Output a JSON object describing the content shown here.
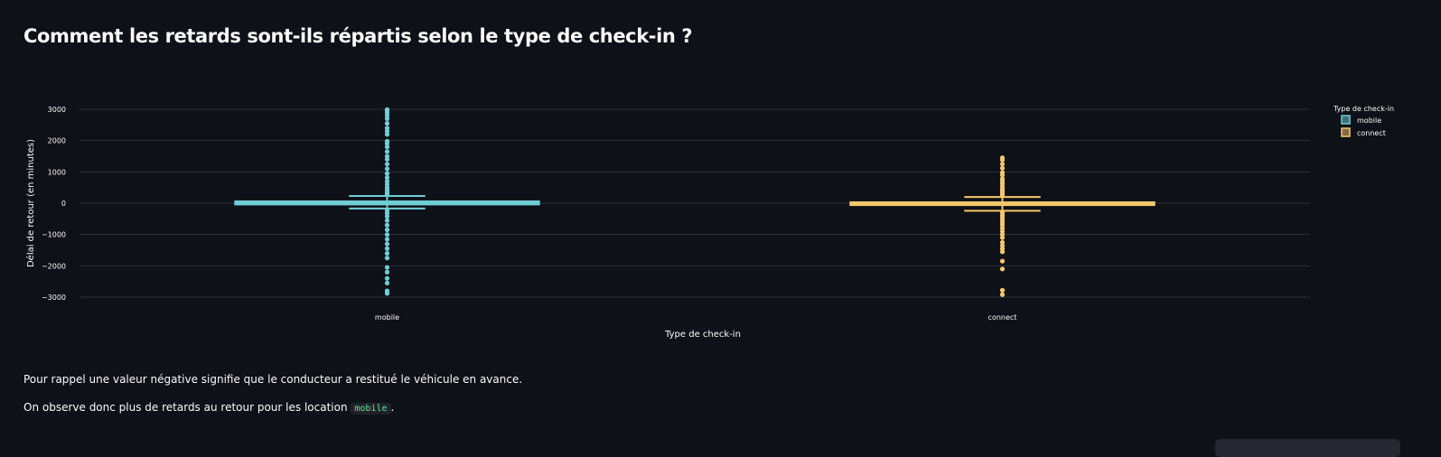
{
  "page": {
    "title": "Comment les retards sont-ils répartis selon le type de check-in ?",
    "note1": "Pour rappel une valeur négative signifie que le conducteur a restitué le véhicule en avance.",
    "note2_before": "On observe donc plus de retards au retour pour les location",
    "note2_code": "mobile",
    "note2_after": "."
  },
  "chart_data": {
    "type": "box",
    "title": "",
    "xlabel": "Type de check-in",
    "ylabel": "Délai de retour (en minutes)",
    "ylim": [
      -3000,
      3000
    ],
    "yticks": [
      3000,
      2000,
      1000,
      0,
      -1000,
      -2000,
      -3000
    ],
    "ytick_labels": [
      "3000",
      "2000",
      "1000",
      "0",
      "−1000",
      "−2000",
      "−3000"
    ],
    "grid": true,
    "legend": {
      "title": "Type de check-in",
      "placement": "top-right"
    },
    "categories": [
      "mobile",
      "connect"
    ],
    "series": [
      {
        "name": "mobile",
        "color": "#6fcfd6",
        "q1": -40,
        "median": 10,
        "q3": 60,
        "whisker_low": -170,
        "whisker_high": 230,
        "outliers": [
          2990,
          2950,
          2880,
          2800,
          2700,
          2550,
          2400,
          2300,
          2200,
          1980,
          1900,
          1800,
          1650,
          1500,
          1400,
          1250,
          1100,
          950,
          820,
          700,
          600,
          500,
          420,
          350,
          300,
          260,
          -240,
          -320,
          -420,
          -550,
          -700,
          -850,
          -1000,
          -1150,
          -1300,
          -1450,
          -1600,
          -1750,
          -2050,
          -2200,
          -2400,
          -2550,
          -2800,
          -2880
        ]
      },
      {
        "name": "connect",
        "color": "#f5c86d",
        "q1": -60,
        "median": -10,
        "q3": 30,
        "whisker_low": -240,
        "whisker_high": 200,
        "outliers": [
          1450,
          1380,
          1250,
          1120,
          980,
          900,
          780,
          700,
          620,
          540,
          460,
          400,
          350,
          300,
          250,
          -300,
          -380,
          -460,
          -540,
          -620,
          -700,
          -800,
          -900,
          -1000,
          -1100,
          -1250,
          -1350,
          -1450,
          -1550,
          -1850,
          -2100,
          -2780,
          -2920
        ]
      }
    ]
  }
}
